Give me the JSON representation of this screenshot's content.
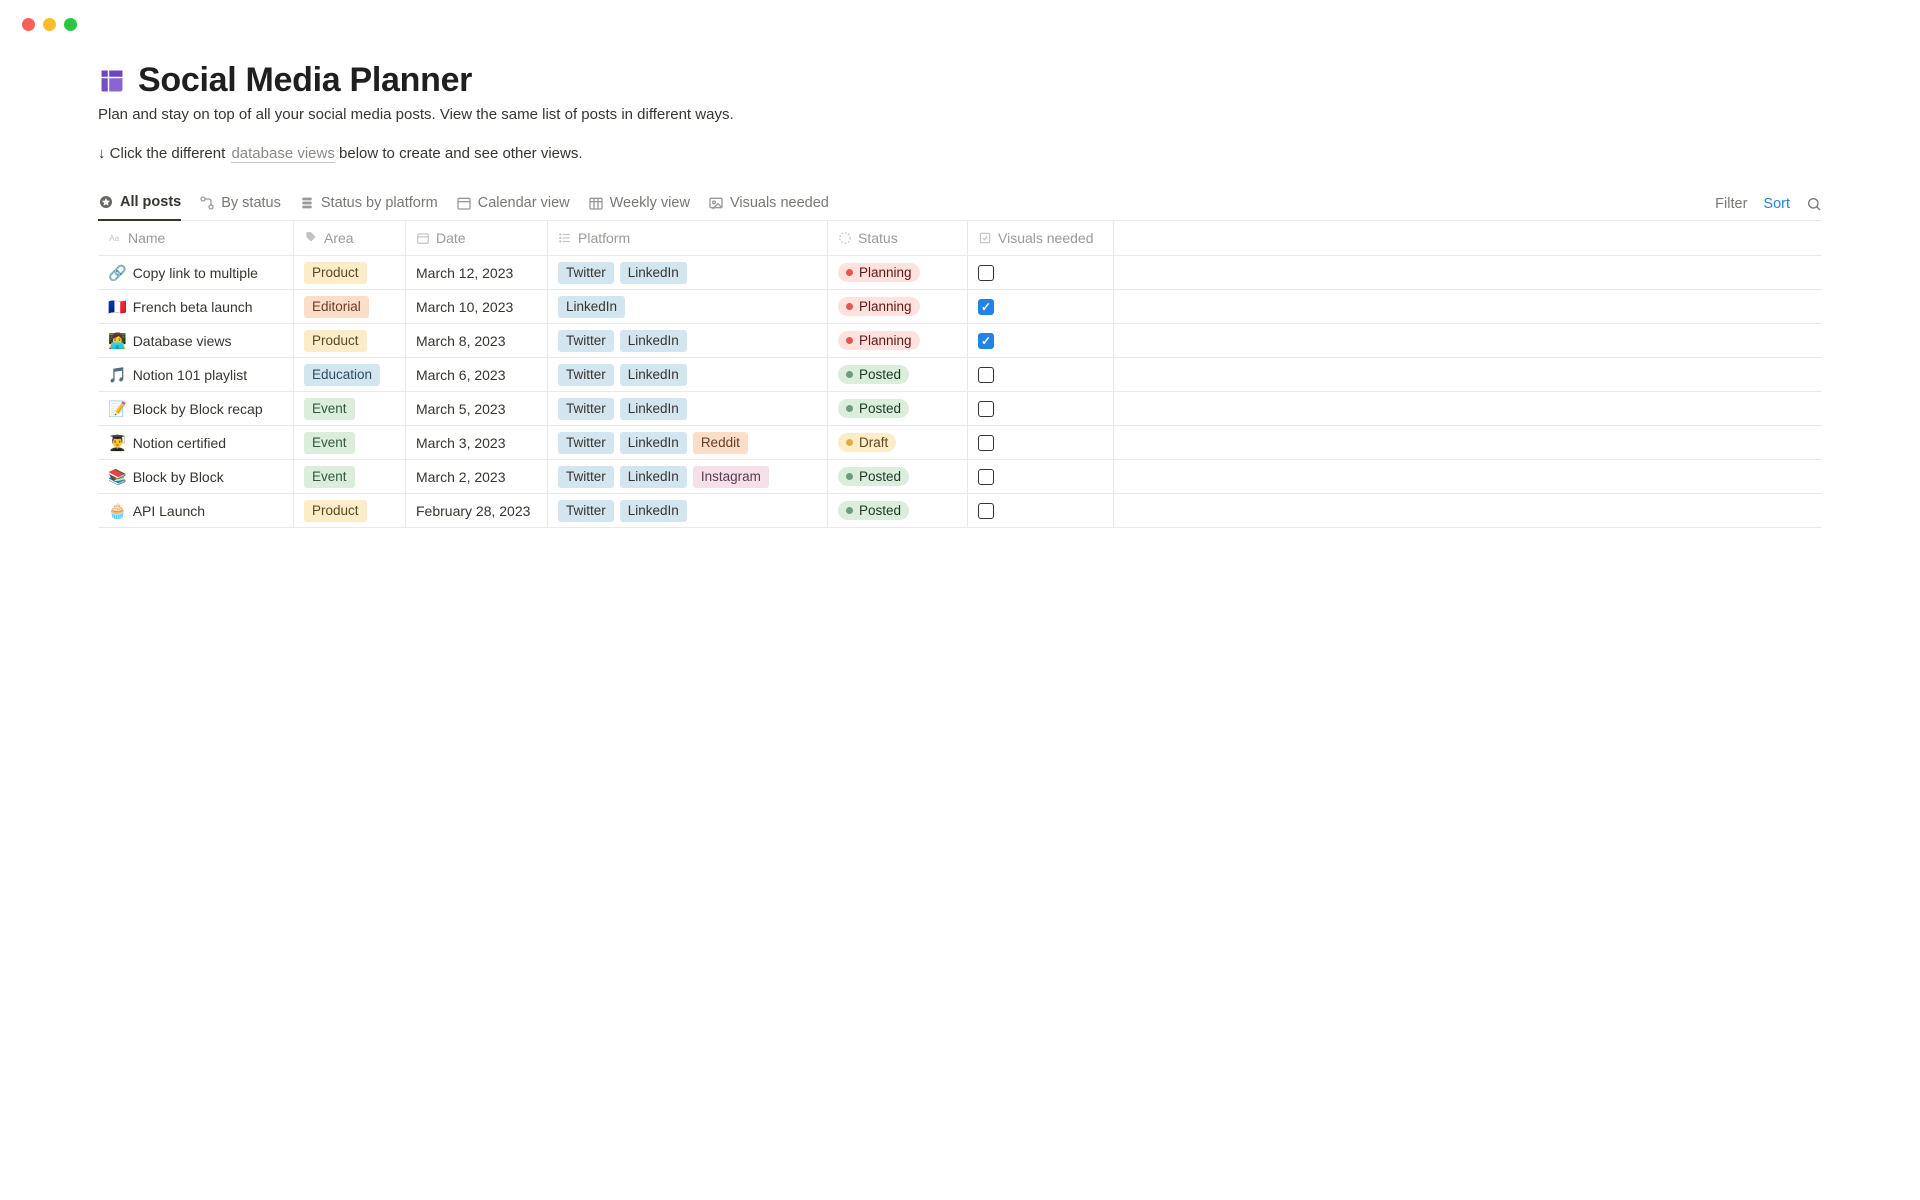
{
  "header": {
    "title": "Social Media Planner",
    "subtitle": "Plan and stay on top of all your social media posts. View the same list of posts in different ways.",
    "hint_prefix": "↓ Click the different ",
    "hint_link": "database views",
    "hint_suffix": " below to create and see other views."
  },
  "tabs": [
    {
      "label": "All posts",
      "active": true,
      "icon": "star"
    },
    {
      "label": "By status",
      "active": false,
      "icon": "flow"
    },
    {
      "label": "Status by platform",
      "active": false,
      "icon": "stack"
    },
    {
      "label": "Calendar view",
      "active": false,
      "icon": "calendar"
    },
    {
      "label": "Weekly view",
      "active": false,
      "icon": "week"
    },
    {
      "label": "Visuals needed",
      "active": false,
      "icon": "image"
    }
  ],
  "toolbar": {
    "filter": "Filter",
    "sort": "Sort"
  },
  "columns": {
    "name": "Name",
    "area": "Area",
    "date": "Date",
    "platform": "Platform",
    "status": "Status",
    "visuals": "Visuals needed"
  },
  "area_labels": {
    "Product": "Product",
    "Editorial": "Editorial",
    "Education": "Education",
    "Event": "Event"
  },
  "platform_labels": {
    "Twitter": "Twitter",
    "LinkedIn": "LinkedIn",
    "Reddit": "Reddit",
    "Instagram": "Instagram"
  },
  "status_labels": {
    "Planning": "Planning",
    "Posted": "Posted",
    "Draft": "Draft"
  },
  "rows": [
    {
      "emoji": "🔗",
      "name": "Copy link to multiple",
      "area": "Product",
      "date": "March 12, 2023",
      "platforms": [
        "Twitter",
        "LinkedIn"
      ],
      "status": "Planning",
      "visuals": false
    },
    {
      "emoji": "🇫🇷",
      "name": "French beta launch",
      "area": "Editorial",
      "date": "March 10, 2023",
      "platforms": [
        "LinkedIn"
      ],
      "status": "Planning",
      "visuals": true
    },
    {
      "emoji": "👩‍💻",
      "name": "Database views",
      "area": "Product",
      "date": "March 8, 2023",
      "platforms": [
        "Twitter",
        "LinkedIn"
      ],
      "status": "Planning",
      "visuals": true
    },
    {
      "emoji": "🎵",
      "name": "Notion 101 playlist",
      "area": "Education",
      "date": "March 6, 2023",
      "platforms": [
        "Twitter",
        "LinkedIn"
      ],
      "status": "Posted",
      "visuals": false
    },
    {
      "emoji": "📝",
      "name": "Block by Block recap",
      "area": "Event",
      "date": "March 5, 2023",
      "platforms": [
        "Twitter",
        "LinkedIn"
      ],
      "status": "Posted",
      "visuals": false
    },
    {
      "emoji": "👨‍🎓",
      "name": "Notion certified",
      "area": "Event",
      "date": "March 3, 2023",
      "platforms": [
        "Twitter",
        "LinkedIn",
        "Reddit"
      ],
      "status": "Draft",
      "visuals": false
    },
    {
      "emoji": "📚",
      "name": "Block by Block",
      "area": "Event",
      "date": "March 2, 2023",
      "platforms": [
        "Twitter",
        "LinkedIn",
        "Instagram"
      ],
      "status": "Posted",
      "visuals": false
    },
    {
      "emoji": "🧁",
      "name": "API Launch",
      "area": "Product",
      "date": "February 28, 2023",
      "platforms": [
        "Twitter",
        "LinkedIn"
      ],
      "status": "Posted",
      "visuals": false
    }
  ]
}
